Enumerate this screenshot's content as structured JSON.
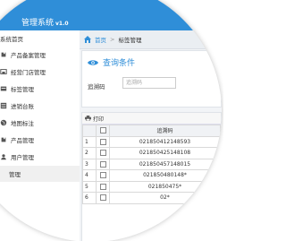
{
  "app": {
    "title": "管理系统",
    "version": "v1.0"
  },
  "header": {
    "close_label": "×",
    "add_label": "+"
  },
  "sidebar": {
    "items": [
      {
        "label": "系统首页",
        "icon": "home-icon"
      },
      {
        "label": "产品备案管理",
        "icon": "puzzle-icon"
      },
      {
        "label": "经营门店管理",
        "icon": "store-icon"
      },
      {
        "label": "标签管理",
        "icon": "tag-icon"
      },
      {
        "label": "进销台账",
        "icon": "ledger-icon"
      },
      {
        "label": "地图标注",
        "icon": "globe-icon"
      },
      {
        "label": "产品管理",
        "icon": "puzzle-icon"
      },
      {
        "label": "用户管理",
        "icon": "user-icon",
        "expandable": true
      },
      {
        "label": "管理",
        "icon": "sub-icon"
      }
    ]
  },
  "breadcrumb": {
    "home": "首页",
    "separator": ">",
    "current": "标签管理"
  },
  "query": {
    "title": "查询条件",
    "label": "追溯码",
    "placeholder": "追溯码"
  },
  "table": {
    "print_label": "打印",
    "header": "追溯码",
    "rows": [
      {
        "num": "1",
        "code": "021850412148593"
      },
      {
        "num": "2",
        "code": "021850425148108"
      },
      {
        "num": "3",
        "code": "021850457148015"
      },
      {
        "num": "4",
        "code": "021850480148*"
      },
      {
        "num": "5",
        "code": "021850475*"
      },
      {
        "num": "6",
        "code": "02*"
      }
    ]
  },
  "colors": {
    "topbar": "#2f8ed8",
    "accent": "#2f8ed8"
  }
}
